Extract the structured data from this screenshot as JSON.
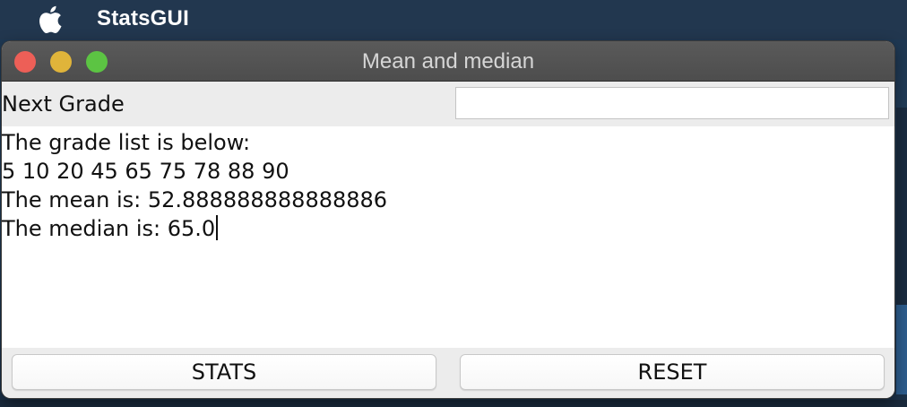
{
  "menubar": {
    "app_name": "StatsGUI"
  },
  "window": {
    "title": "Mean and median"
  },
  "form": {
    "next_grade_label": "Next Grade",
    "next_grade_value": "",
    "next_grade_placeholder": ""
  },
  "output": {
    "lines": [
      "The grade list is below:",
      "5 10 20 45 65 75 78 88 90",
      "The mean is: 52.888888888888886",
      "The median is: 65.0"
    ]
  },
  "buttons": {
    "stats_label": "STATS",
    "reset_label": "RESET"
  },
  "icons": {
    "apple": "apple-icon",
    "close": "close-icon",
    "minimize": "minimize-icon",
    "zoom": "zoom-icon"
  },
  "colors": {
    "close": "#ed5f57",
    "minimize": "#e0b43a",
    "zoom": "#5cc443"
  }
}
